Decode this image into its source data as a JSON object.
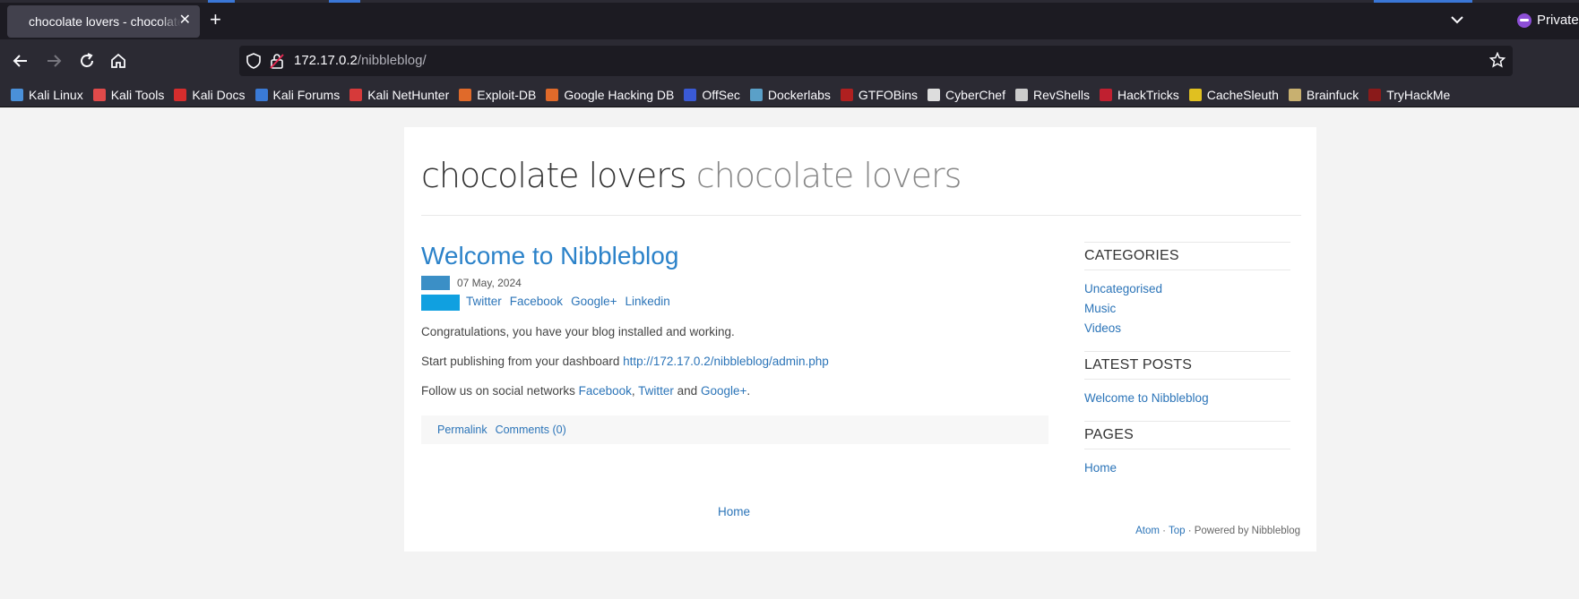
{
  "browser": {
    "tab_title": "chocolate lovers - chocolate lovers",
    "private_label": "Private",
    "url_host": "172.17.0.2",
    "url_path": "/nibbleblog/"
  },
  "bookmarks": [
    {
      "label": "Kali Linux",
      "icon": "kali-icon",
      "color": "#4a90d9"
    },
    {
      "label": "Kali Tools",
      "icon": "kali-tools-icon",
      "color": "#e04a4a"
    },
    {
      "label": "Kali Docs",
      "icon": "kali-docs-icon",
      "color": "#d62d2d"
    },
    {
      "label": "Kali Forums",
      "icon": "kali-forums-icon",
      "color": "#3a7ad6"
    },
    {
      "label": "Kali NetHunter",
      "icon": "nethunter-icon",
      "color": "#d63a3a"
    },
    {
      "label": "Exploit-DB",
      "icon": "exploit-db-icon",
      "color": "#e06a2a"
    },
    {
      "label": "Google Hacking DB",
      "icon": "ghdb-icon",
      "color": "#e06a2a"
    },
    {
      "label": "OffSec",
      "icon": "offsec-icon",
      "color": "#3a5ad6"
    },
    {
      "label": "Dockerlabs",
      "icon": "dockerlabs-icon",
      "color": "#5aa0c8"
    },
    {
      "label": "GTFOBins",
      "icon": "gtfobins-icon",
      "color": "#b02020"
    },
    {
      "label": "CyberChef",
      "icon": "cyberchef-icon",
      "color": "#dddddd"
    },
    {
      "label": "RevShells",
      "icon": "revshells-icon",
      "color": "#cccccc"
    },
    {
      "label": "HackTricks",
      "icon": "hacktricks-icon",
      "color": "#c02030"
    },
    {
      "label": "CacheSleuth",
      "icon": "cachesleuth-icon",
      "color": "#e0c020"
    },
    {
      "label": "Brainfuck",
      "icon": "brainfuck-icon",
      "color": "#c8b070"
    },
    {
      "label": "TryHackMe",
      "icon": "tryhackme-icon",
      "color": "#8a1a1a"
    }
  ],
  "blog": {
    "name": "chocolate lovers",
    "slogan": "chocolate lovers"
  },
  "post": {
    "title": "Welcome to Nibbleblog",
    "date": "07 May, 2024",
    "share": [
      "Twitter",
      "Facebook",
      "Google+",
      "Linkedin"
    ],
    "line1": "Congratulations, you have your blog installed and working.",
    "line2_prefix": "Start publishing from your dashboard ",
    "line2_link": "http://172.17.0.2/nibbleblog/admin.php",
    "line3_prefix": "Follow us on social networks ",
    "line3_link1": "Facebook",
    "line3_sep": ", ",
    "line3_link2": "Twitter",
    "line3_and": " and ",
    "line3_link3": "Google+",
    "line3_end": ".",
    "permalink": "Permalink",
    "comments": "Comments (0)"
  },
  "pager": {
    "home": "Home"
  },
  "sidebar": {
    "categories_title": "CATEGORIES",
    "categories": [
      "Uncategorised",
      "Music",
      "Videos"
    ],
    "latest_title": "LATEST POSTS",
    "latest": [
      "Welcome to Nibbleblog"
    ],
    "pages_title": "PAGES",
    "pages": [
      "Home"
    ]
  },
  "footer": {
    "atom": "Atom",
    "sep": " · ",
    "top": "Top",
    "powered": " · Powered by Nibbleblog"
  }
}
